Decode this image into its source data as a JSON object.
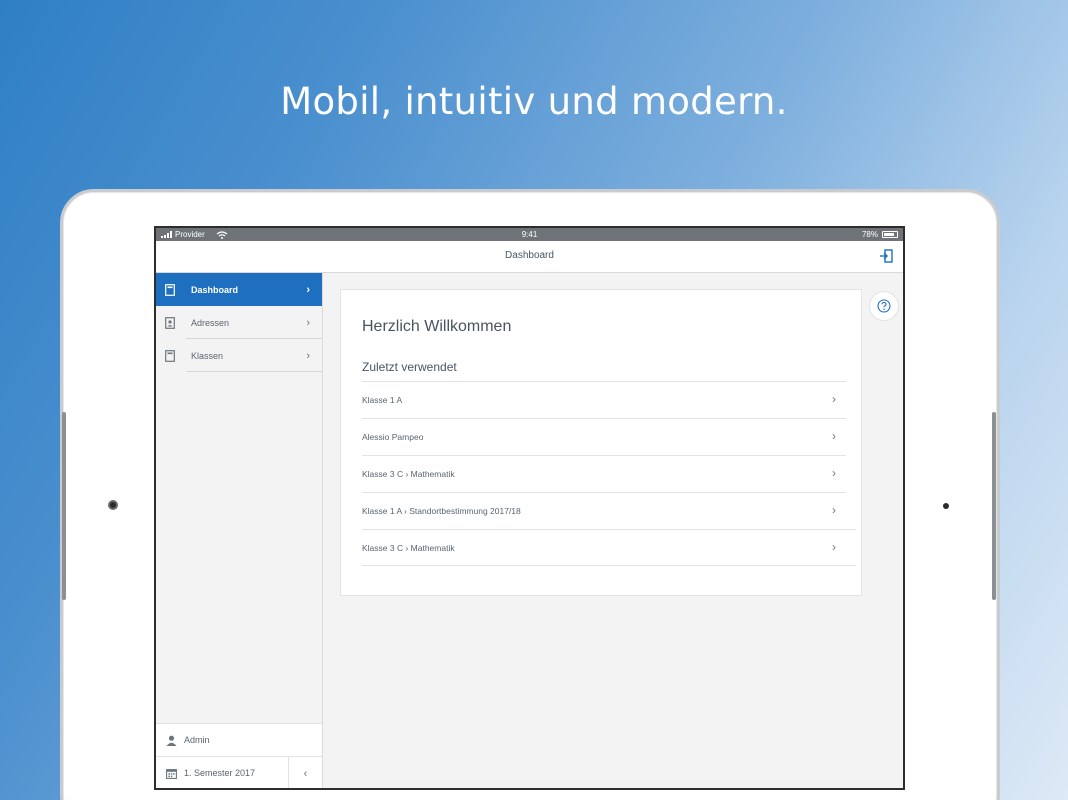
{
  "headline": "Mobil, intuitiv und modern.",
  "statusbar": {
    "carrier": "Provider",
    "time": "9:41",
    "battery": "78%"
  },
  "navbar": {
    "title": "Dashboard",
    "logout_icon": "logout-icon"
  },
  "sidebar": {
    "items": [
      {
        "label": "Dashboard",
        "icon": "document-icon",
        "active": true
      },
      {
        "label": "Adressen",
        "icon": "contact-card-icon",
        "active": false
      },
      {
        "label": "Klassen",
        "icon": "document-icon",
        "active": false
      }
    ],
    "user": {
      "label": "Admin",
      "icon": "user-icon"
    },
    "semester": {
      "label": "1. Semester 2017",
      "icon": "calendar-icon"
    },
    "collapse_glyph": "‹"
  },
  "main": {
    "welcome": "Herzlich Willkommen",
    "recent_title": "Zuletzt verwendet",
    "recent_items": [
      "Klasse 1 A",
      "Alessio Pampeo",
      "Klasse 3 C › Mathematik",
      "Klasse 1 A › Standortbestimmung 2017/18",
      "Klasse 3 C › Mathematik"
    ],
    "help_icon": "help-icon"
  },
  "colors": {
    "accent": "#1f6fc0",
    "text": "#4a5560",
    "background": "#f3f3f3"
  }
}
